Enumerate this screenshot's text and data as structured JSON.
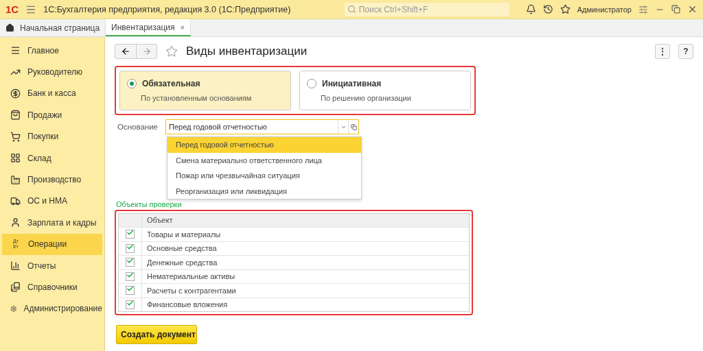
{
  "window": {
    "logo": "1С",
    "title": "1С:Бухгалтерия предприятия, редакция 3.0  (1С:Предприятие)",
    "search_placeholder": "Поиск Ctrl+Shift+F",
    "user": "Администратор"
  },
  "tabs": [
    {
      "label": "Начальная страница",
      "selected": false,
      "kind": "home"
    },
    {
      "label": "Инвентаризация",
      "selected": true,
      "kind": "doc",
      "close": "×"
    }
  ],
  "sidebar": {
    "items": [
      {
        "label": "Главное",
        "kind": "icon",
        "selected": false
      },
      {
        "label": "Руководителю",
        "kind": "icon",
        "selected": false
      },
      {
        "label": "Банк и касса",
        "kind": "icon",
        "selected": false
      },
      {
        "label": "Продажи",
        "kind": "icon",
        "selected": false
      },
      {
        "label": "Покупки",
        "kind": "icon",
        "selected": false
      },
      {
        "label": "Склад",
        "kind": "icon",
        "selected": false
      },
      {
        "label": "Производство",
        "kind": "icon",
        "selected": false
      },
      {
        "label": "ОС и НМА",
        "kind": "icon",
        "selected": false
      },
      {
        "label": "Зарплата и кадры",
        "kind": "icon",
        "selected": false
      },
      {
        "label": "Операции",
        "kind": "text_icon",
        "icon_text": [
          "Дт",
          "Кт"
        ],
        "selected": true
      },
      {
        "label": "Отчеты",
        "kind": "icon",
        "selected": false
      },
      {
        "label": "Справочники",
        "kind": "icon",
        "selected": false
      },
      {
        "label": "Администрирование",
        "kind": "icon",
        "selected": false
      }
    ]
  },
  "form": {
    "title": "Виды инвентаризации",
    "more": "⋮",
    "help": "?",
    "types": [
      {
        "title": "Обязательная",
        "subtitle": "По установленным основаниям",
        "selected": true
      },
      {
        "title": "Инициативная",
        "subtitle": "По решению организации",
        "selected": false
      }
    ],
    "basis": {
      "label": "Основание",
      "value": "Перед годовой отчетностью",
      "options": [
        {
          "label": "Перед годовой отчетностью",
          "selected": true
        },
        {
          "label": "Смена материально ответственного лица",
          "selected": false
        },
        {
          "label": "Пожар или чрезвычайная ситуация",
          "selected": false
        },
        {
          "label": "Реорганизация или ликвидация",
          "selected": false
        }
      ]
    },
    "objects_title": "Объекты проверки",
    "table": {
      "columns": [
        "Объект"
      ],
      "rows": [
        {
          "name": "Товары и материалы",
          "checked": true
        },
        {
          "name": "Основные средства",
          "checked": true
        },
        {
          "name": "Денежные средства",
          "checked": true
        },
        {
          "name": "Нематериальные активы",
          "checked": true
        },
        {
          "name": "Расчеты с контрагентами",
          "checked": true
        },
        {
          "name": "Финансовые вложения",
          "checked": true
        }
      ]
    },
    "create_button": "Создать документ"
  }
}
